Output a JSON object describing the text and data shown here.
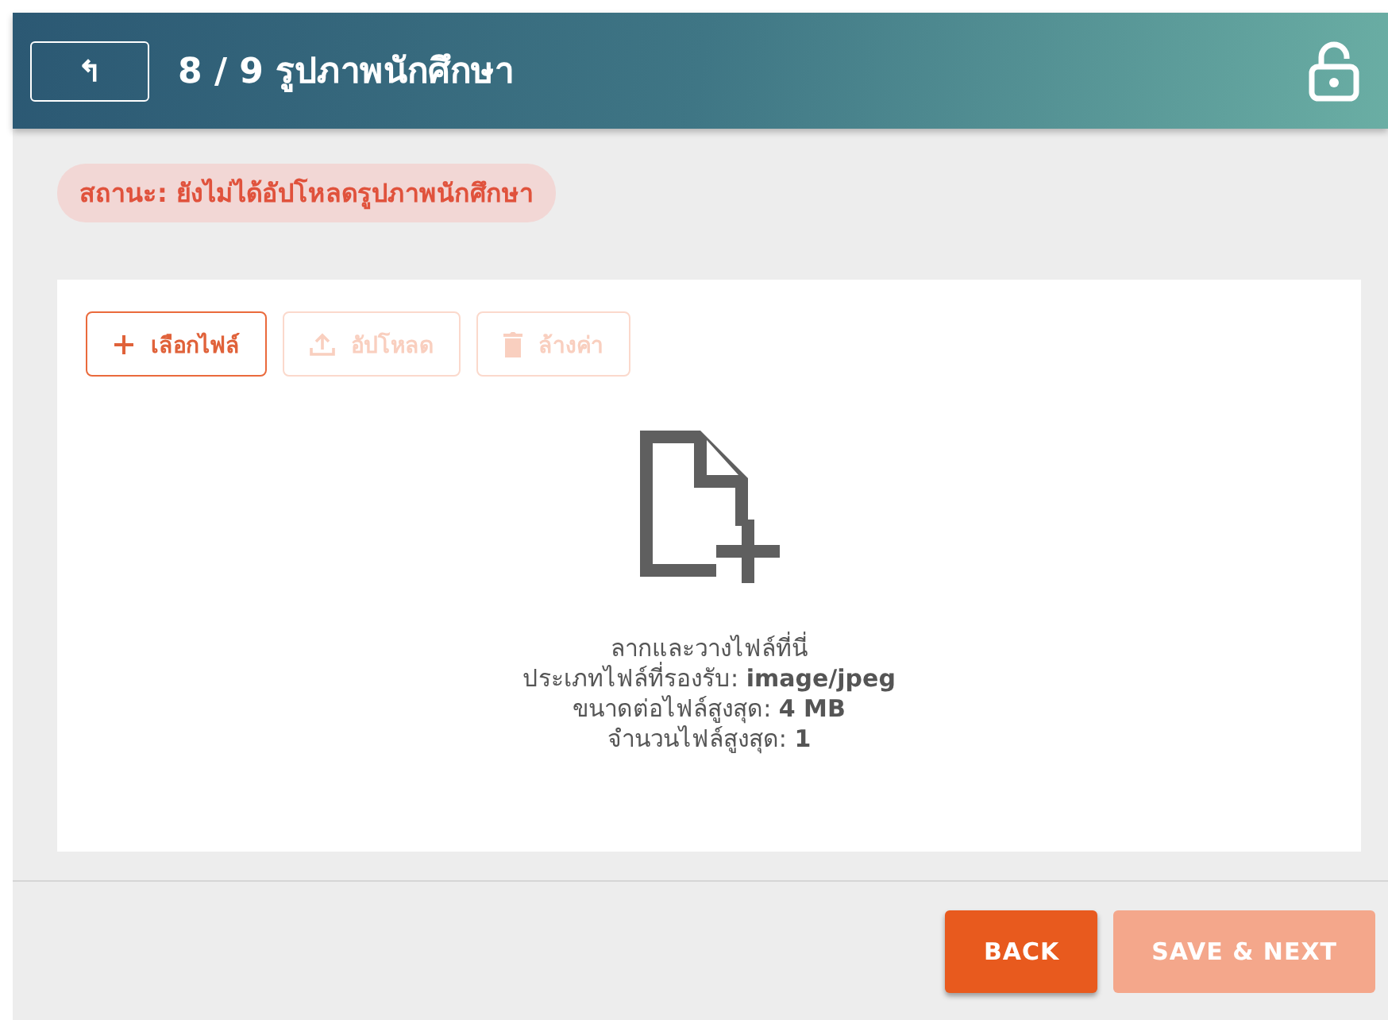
{
  "header": {
    "back_symbol": "↰",
    "title": "8 / 9 รูปภาพนักศึกษา",
    "locked": false
  },
  "status": {
    "text": "สถานะ:  ยังไม่ได้อัปโหลดรูปภาพนักศึกษา"
  },
  "toolbar": [
    {
      "kind": "add",
      "label": "เลือกไฟล์",
      "disabled": false
    },
    {
      "kind": "upload",
      "label": "อัปโหลด",
      "disabled": true
    },
    {
      "kind": "clear",
      "label": "ล้างค่า",
      "disabled": true
    }
  ],
  "dropzone": {
    "lines": [
      "ลากและวางไฟล์ที่นี่",
      "ประเภทไฟล์ที่รองรับ: **image/jpeg**",
      "ขนาดต่อไฟล์สูงสุด: **4 MB**",
      "จำนวนไฟล์สูงสุด: **1**"
    ]
  },
  "footer": {
    "buttons": [
      {
        "label": "BACK",
        "disabled": false
      },
      {
        "label": "SAVE & NEXT",
        "disabled": true
      }
    ]
  }
}
